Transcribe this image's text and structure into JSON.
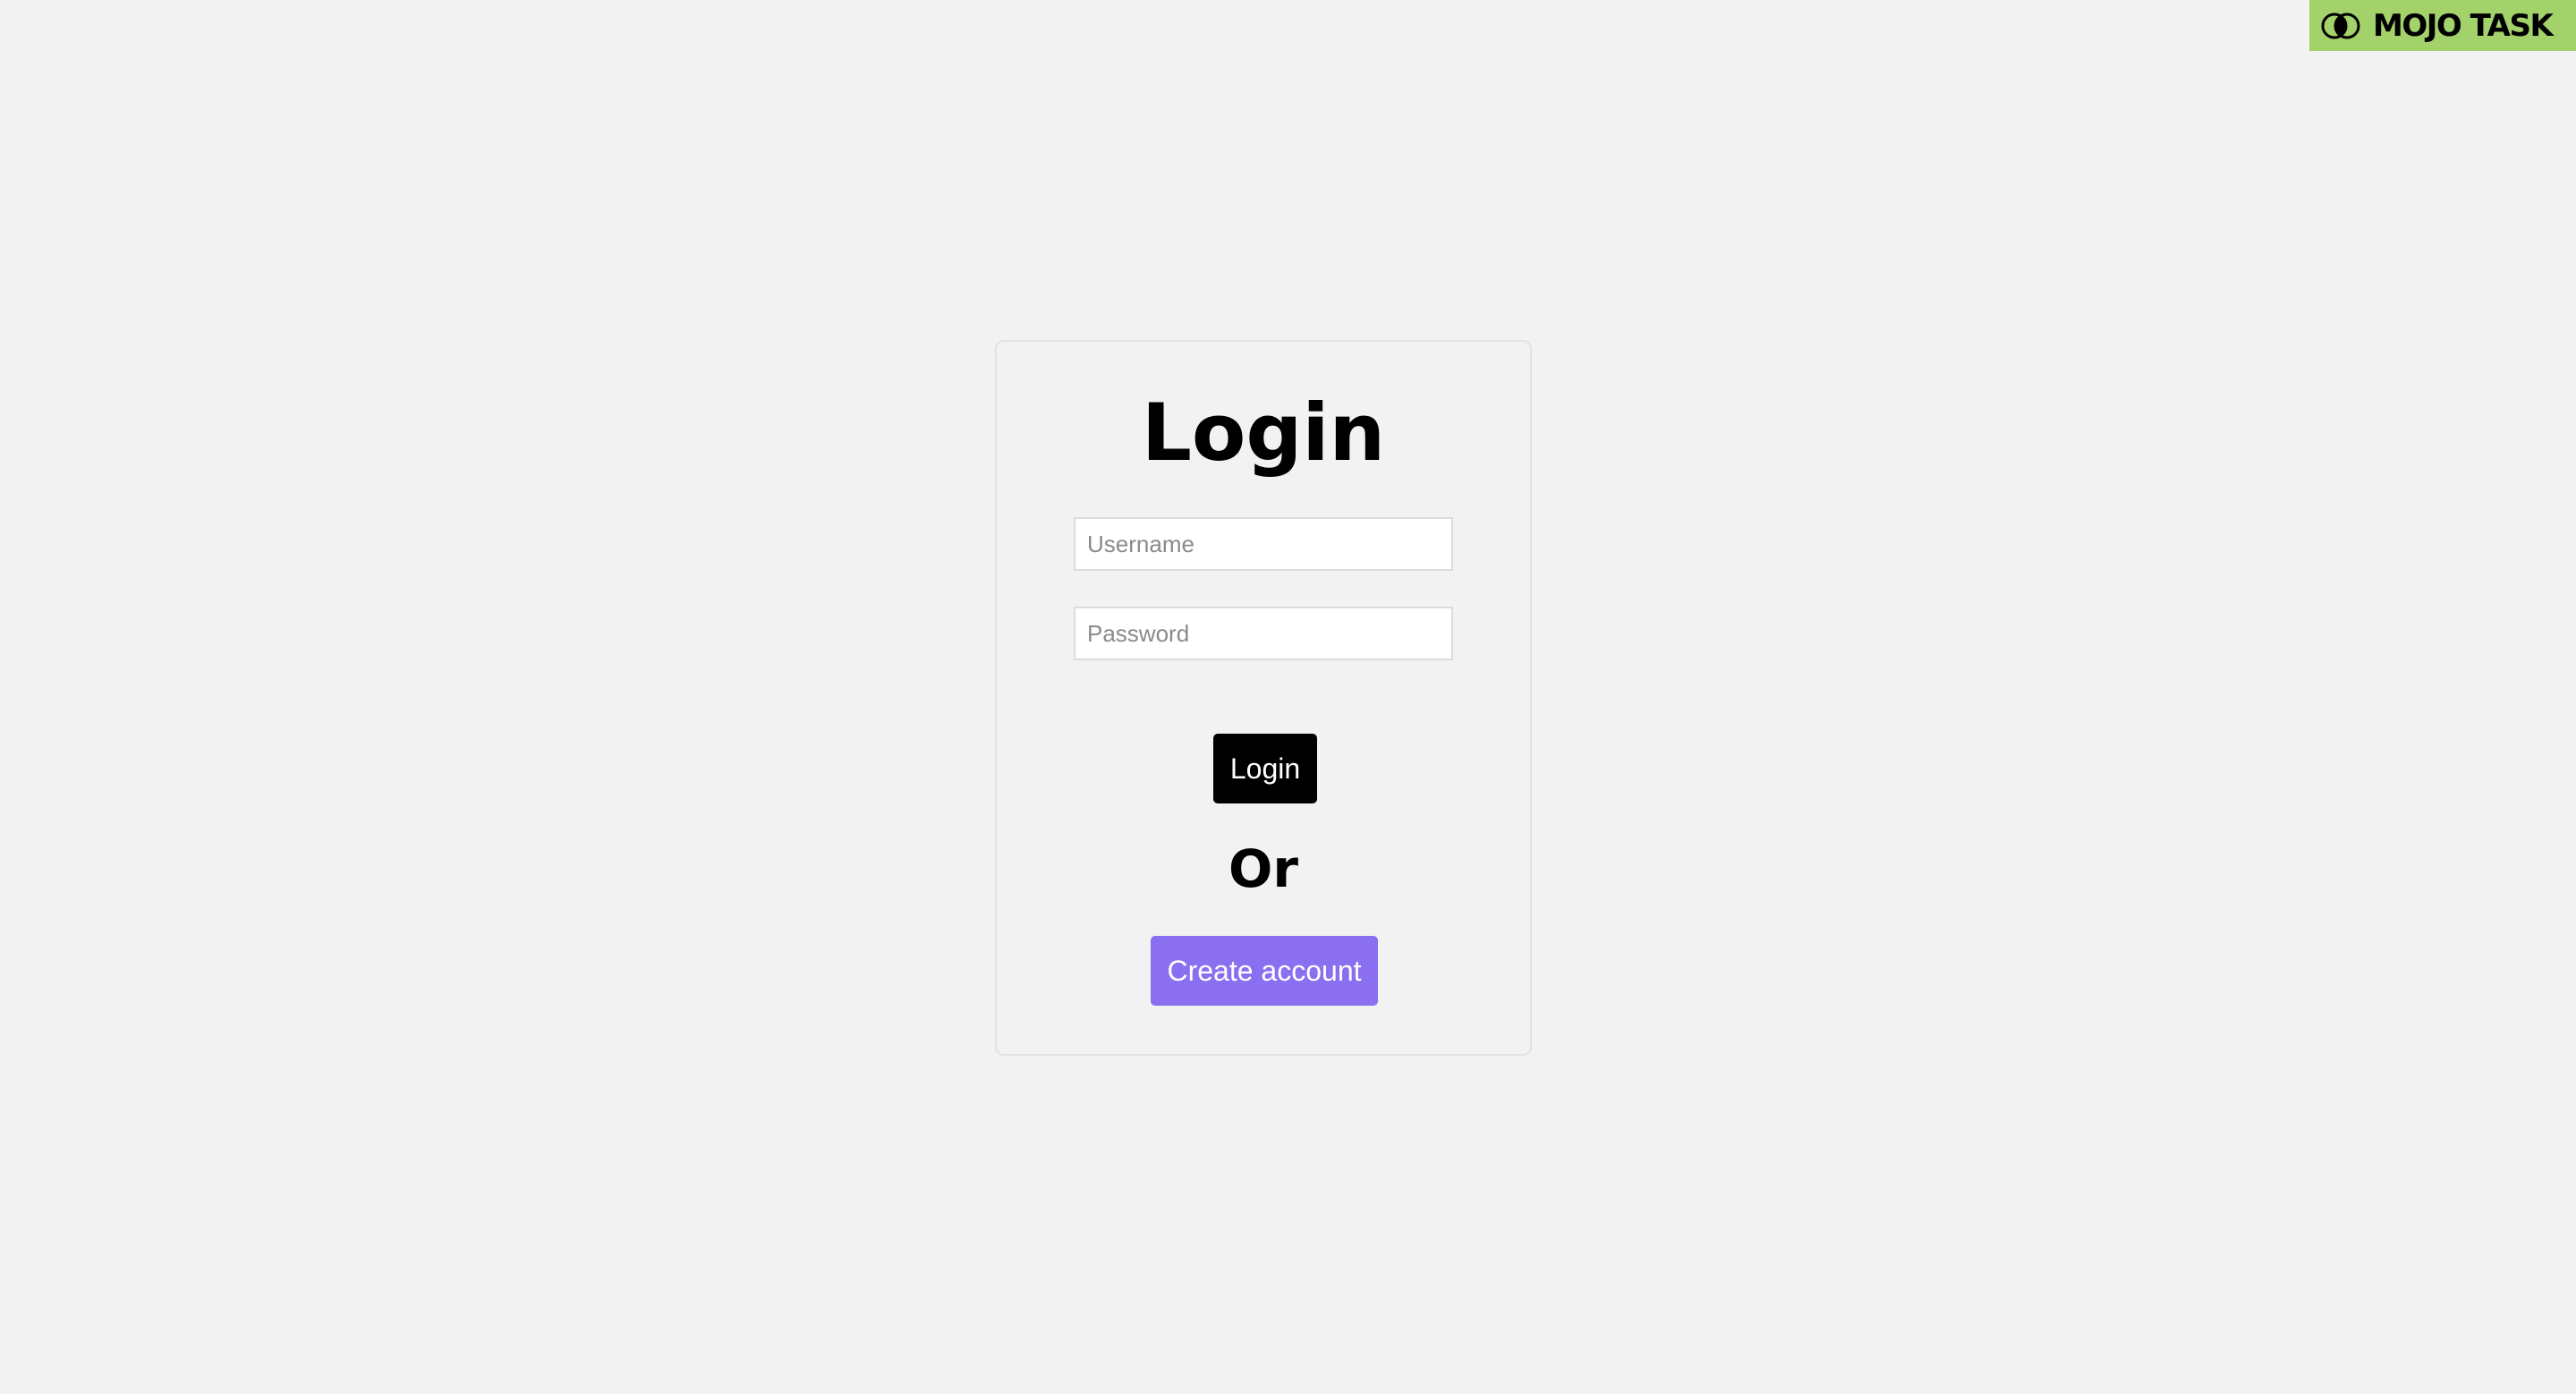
{
  "brand": {
    "name": "MOJO TASK",
    "icon": "overlapping-circles-logo-icon",
    "background": "#a4d26a"
  },
  "login_card": {
    "title": "Login",
    "username": {
      "value": "",
      "placeholder": "Username"
    },
    "password": {
      "value": "",
      "placeholder": "Password"
    },
    "login_label": "Login",
    "separator": "Or",
    "create_account_label": "Create account"
  },
  "colors": {
    "page_background": "#f2f2f2",
    "login_button": "#000000",
    "create_account_button": "#8a6ff0"
  }
}
